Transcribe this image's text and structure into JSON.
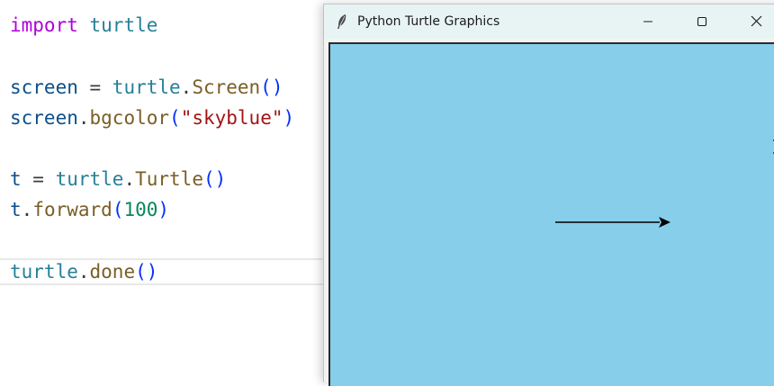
{
  "editor": {
    "peek_line": "    ",
    "line1": {
      "kw": "import",
      "mod": "turtle"
    },
    "line2": {
      "var": "screen",
      "op": " = ",
      "mod": "turtle",
      "dot": ".",
      "fn": "Screen",
      "args": "()"
    },
    "line3": {
      "var": "screen",
      "dot": ".",
      "fn": "bgcolor",
      "open": "(",
      "str": "\"skyblue\"",
      "close": ")"
    },
    "line4": {
      "var": "t",
      "op": " = ",
      "mod": "turtle",
      "dot": ".",
      "fn": "Turtle",
      "args": "()"
    },
    "line5": {
      "var": "t",
      "dot": ".",
      "fn": "forward",
      "open": "(",
      "num": "100",
      "close": ")"
    },
    "line6": {
      "mod": "turtle",
      "dot": ".",
      "fn": "done",
      "args": "()"
    }
  },
  "turtle_window": {
    "title": "Python Turtle Graphics",
    "app_icon": "feather-icon",
    "controls": [
      "minimize-icon",
      "maximize-icon",
      "close-icon"
    ],
    "canvas_color": "#87ceeb",
    "turtle_shape": "arrow",
    "line_color": "#000000"
  },
  "colors": {
    "keyword": "#af00db",
    "module": "#267f99",
    "function": "#795e26",
    "string": "#a31515",
    "number": "#098658",
    "paren": "#0431fa"
  }
}
